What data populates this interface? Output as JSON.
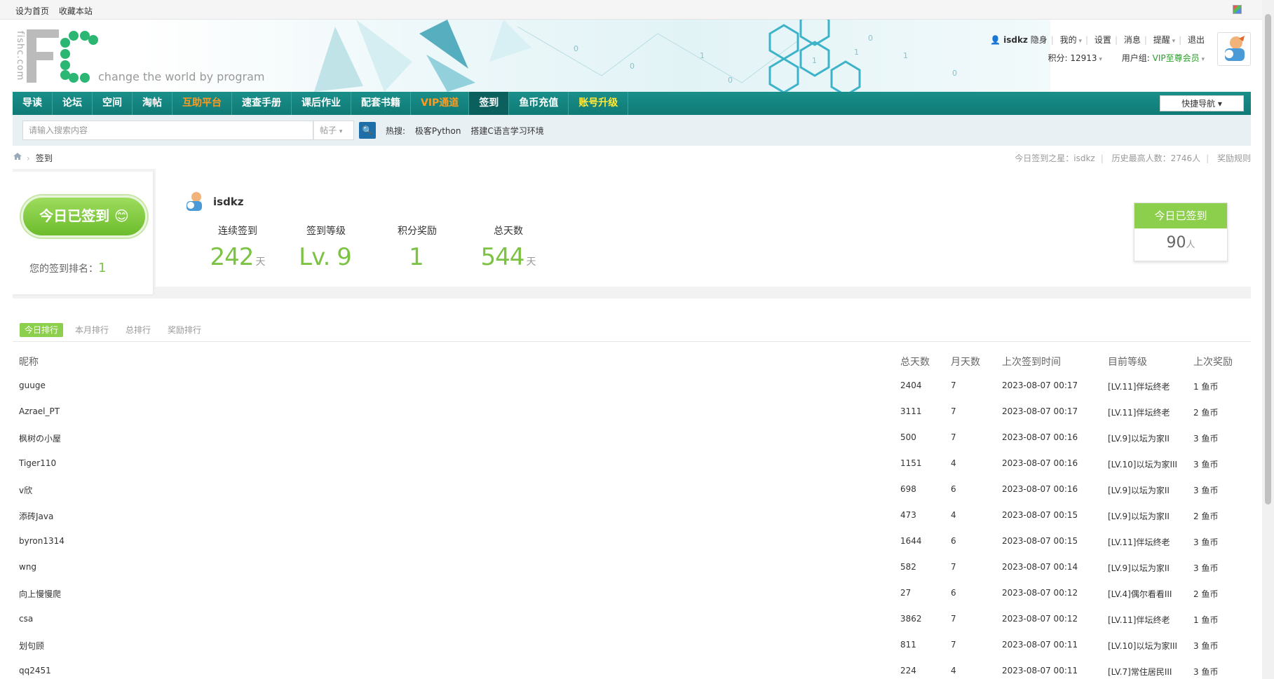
{
  "topbar": {
    "set_home": "设为首页",
    "bookmark": "收藏本站"
  },
  "header": {
    "logo_vertical": "fishc.com",
    "slogan": "change the world by program",
    "user": {
      "name": "isdkz",
      "invisible": "隐身",
      "mine": "我的",
      "settings": "设置",
      "messages": "消息",
      "reminders": "提醒",
      "logout": "退出",
      "points_label": "积分: 12913",
      "group_label": "用户组: ",
      "group_value": "VIP至尊会员"
    }
  },
  "nav": {
    "items": [
      {
        "label": "导读",
        "color": ""
      },
      {
        "label": "论坛",
        "color": ""
      },
      {
        "label": "空间",
        "color": ""
      },
      {
        "label": "淘帖",
        "color": ""
      },
      {
        "label": "互助平台",
        "color": "orange"
      },
      {
        "label": "速查手册",
        "color": ""
      },
      {
        "label": "课后作业",
        "color": ""
      },
      {
        "label": "配套书籍",
        "color": ""
      },
      {
        "label": "VIP通道",
        "color": "orange"
      },
      {
        "label": "签到",
        "color": "",
        "active": true
      },
      {
        "label": "鱼币充值",
        "color": ""
      },
      {
        "label": "账号升级",
        "color": "yellow"
      }
    ],
    "quick_nav": "快捷导航"
  },
  "search": {
    "placeholder": "请输入搜索内容",
    "type": "帖子",
    "hot_label": "热搜:",
    "hot_items": [
      "极客Python",
      "搭建C语言学习环境"
    ]
  },
  "breadcrumb": {
    "current": "签到",
    "star": "今日签到之星：isdkz",
    "record": "历史最高人数：2746人",
    "rules": "奖励规则"
  },
  "sign": {
    "button_label": "今日已签到 😊",
    "rank_label": "您的签到排名：",
    "rank_value": "1",
    "username": "isdkz",
    "stats": [
      {
        "label": "连续签到",
        "value": "242",
        "unit": "天"
      },
      {
        "label": "签到等级",
        "value": "Lv. 9",
        "unit": ""
      },
      {
        "label": "积分奖励",
        "value": "1",
        "unit": ""
      },
      {
        "label": "总天数",
        "value": "544",
        "unit": "天"
      }
    ],
    "today_title": "今日已签到",
    "today_count": "90",
    "today_unit": "人"
  },
  "tabs": [
    "今日排行",
    "本月排行",
    "总排行",
    "奖励排行"
  ],
  "table": {
    "headers": [
      "昵称",
      "总天数",
      "月天数",
      "上次签到时间",
      "目前等级",
      "上次奖励"
    ],
    "rows": [
      [
        "guuge",
        "2404",
        "7",
        "2023-08-07 00:17",
        "[LV.11]伴坛终老",
        "1 鱼币"
      ],
      [
        "Azrael_PT",
        "3111",
        "7",
        "2023-08-07 00:17",
        "[LV.11]伴坛终老",
        "2 鱼币"
      ],
      [
        "枫树の小屋",
        "500",
        "7",
        "2023-08-07 00:16",
        "[LV.9]以坛为家II",
        "3 鱼币"
      ],
      [
        "Tiger110",
        "1151",
        "4",
        "2023-08-07 00:16",
        "[LV.10]以坛为家III",
        "3 鱼币"
      ],
      [
        "v欣",
        "698",
        "6",
        "2023-08-07 00:16",
        "[LV.9]以坛为家II",
        "3 鱼币"
      ],
      [
        "添砖Java",
        "473",
        "4",
        "2023-08-07 00:15",
        "[LV.9]以坛为家II",
        "2 鱼币"
      ],
      [
        "byron1314",
        "1644",
        "6",
        "2023-08-07 00:15",
        "[LV.11]伴坛终老",
        "3 鱼币"
      ],
      [
        "wng",
        "582",
        "7",
        "2023-08-07 00:14",
        "[LV.9]以坛为家II",
        "3 鱼币"
      ],
      [
        "向上慢慢爬",
        "27",
        "6",
        "2023-08-07 00:12",
        "[LV.4]偶尔看看III",
        "2 鱼币"
      ],
      [
        "csa",
        "3862",
        "7",
        "2023-08-07 00:12",
        "[LV.11]伴坛终老",
        "1 鱼币"
      ],
      [
        "划句顾",
        "811",
        "7",
        "2023-08-07 00:11",
        "[LV.10]以坛为家III",
        "3 鱼币"
      ],
      [
        "qq2451",
        "224",
        "4",
        "2023-08-07 00:11",
        "[LV.7]常住居民III",
        "3 鱼币"
      ]
    ]
  },
  "colors": {
    "nav": "#0f7a76",
    "accent_green": "#7cc344",
    "orange": "#ff9a1f",
    "yellow": "#ffe93b"
  }
}
